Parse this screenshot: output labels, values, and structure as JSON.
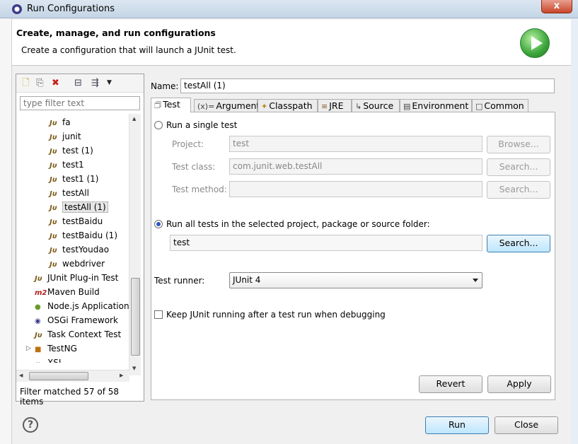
{
  "window": {
    "title": "Run Configurations",
    "close_glyph": "x"
  },
  "banner": {
    "heading": "Create, manage, and run configurations",
    "description": "Create a configuration that will launch a JUnit test."
  },
  "left": {
    "filter_placeholder": "type filter text",
    "tree": [
      {
        "label": "fa",
        "icon": "junit-icon",
        "indent": 2
      },
      {
        "label": "junit",
        "icon": "junit-icon",
        "indent": 2
      },
      {
        "label": "test (1)",
        "icon": "junit-icon",
        "indent": 2
      },
      {
        "label": "test1",
        "icon": "junit-icon",
        "indent": 2
      },
      {
        "label": "test1 (1)",
        "icon": "junit-icon",
        "indent": 2
      },
      {
        "label": "testAll",
        "icon": "junit-icon",
        "indent": 2
      },
      {
        "label": "testAll (1)",
        "icon": "junit-icon",
        "indent": 2,
        "selected": true
      },
      {
        "label": "testBaidu",
        "icon": "junit-icon",
        "indent": 2
      },
      {
        "label": "testBaidu (1)",
        "icon": "junit-icon",
        "indent": 2
      },
      {
        "label": "testYoudao",
        "icon": "junit-icon",
        "indent": 2
      },
      {
        "label": "webdriver",
        "icon": "junit-icon",
        "indent": 2
      },
      {
        "label": "JUnit Plug-in Test",
        "icon": "junit-plugin-icon",
        "indent": 1
      },
      {
        "label": "Maven Build",
        "icon": "maven-icon",
        "indent": 1
      },
      {
        "label": "Node.js Application",
        "icon": "nodejs-icon",
        "indent": 1
      },
      {
        "label": "OSGi Framework",
        "icon": "osgi-icon",
        "indent": 1
      },
      {
        "label": "Task Context Test",
        "icon": "task-context-icon",
        "indent": 1
      },
      {
        "label": "TestNG",
        "icon": "testng-icon",
        "indent": 1,
        "expandable": true
      },
      {
        "label": "XSL",
        "icon": "xsl-icon",
        "indent": 1
      }
    ],
    "filter_status": "Filter matched 57 of 58 items"
  },
  "right": {
    "name_label": "Name:",
    "name_value": "testAll (1)",
    "tabs": [
      {
        "label": "Test",
        "icon": "test-tab-icon",
        "active": true
      },
      {
        "label": "Arguments",
        "icon": "arguments-icon"
      },
      {
        "label": "Classpath",
        "icon": "classpath-icon"
      },
      {
        "label": "JRE",
        "icon": "jre-icon"
      },
      {
        "label": "Source",
        "icon": "source-icon"
      },
      {
        "label": "Environment",
        "icon": "environment-icon"
      },
      {
        "label": "Common",
        "icon": "common-icon"
      }
    ],
    "single_test": {
      "radio_label": "Run a single test",
      "project_label": "Project:",
      "project_value": "test",
      "browse_label": "Browse...",
      "class_label": "Test class:",
      "class_value": "com.junit.web.testAll",
      "class_search_label": "Search...",
      "method_label": "Test method:",
      "method_value": "",
      "method_search_label": "Search..."
    },
    "all_tests": {
      "radio_label": "Run all tests in the selected project, package or source folder:",
      "container_value": "test",
      "search_label": "Search..."
    },
    "runner": {
      "label": "Test runner:",
      "selected": "JUnit 4"
    },
    "keep_running_label": "Keep JUnit running after a test run when debugging",
    "revert_label": "Revert",
    "apply_label": "Apply"
  },
  "footer": {
    "help_glyph": "?",
    "run_label": "Run",
    "close_label": "Close"
  }
}
